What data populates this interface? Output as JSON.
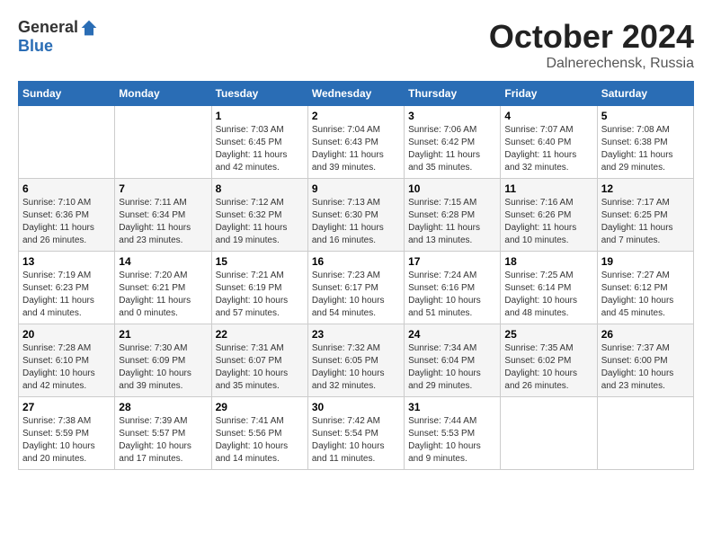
{
  "header": {
    "logo_general": "General",
    "logo_blue": "Blue",
    "month": "October 2024",
    "location": "Dalnerechensk, Russia"
  },
  "days_of_week": [
    "Sunday",
    "Monday",
    "Tuesday",
    "Wednesday",
    "Thursday",
    "Friday",
    "Saturday"
  ],
  "weeks": [
    [
      {
        "num": "",
        "detail": ""
      },
      {
        "num": "",
        "detail": ""
      },
      {
        "num": "1",
        "detail": "Sunrise: 7:03 AM\nSunset: 6:45 PM\nDaylight: 11 hours and 42 minutes."
      },
      {
        "num": "2",
        "detail": "Sunrise: 7:04 AM\nSunset: 6:43 PM\nDaylight: 11 hours and 39 minutes."
      },
      {
        "num": "3",
        "detail": "Sunrise: 7:06 AM\nSunset: 6:42 PM\nDaylight: 11 hours and 35 minutes."
      },
      {
        "num": "4",
        "detail": "Sunrise: 7:07 AM\nSunset: 6:40 PM\nDaylight: 11 hours and 32 minutes."
      },
      {
        "num": "5",
        "detail": "Sunrise: 7:08 AM\nSunset: 6:38 PM\nDaylight: 11 hours and 29 minutes."
      }
    ],
    [
      {
        "num": "6",
        "detail": "Sunrise: 7:10 AM\nSunset: 6:36 PM\nDaylight: 11 hours and 26 minutes."
      },
      {
        "num": "7",
        "detail": "Sunrise: 7:11 AM\nSunset: 6:34 PM\nDaylight: 11 hours and 23 minutes."
      },
      {
        "num": "8",
        "detail": "Sunrise: 7:12 AM\nSunset: 6:32 PM\nDaylight: 11 hours and 19 minutes."
      },
      {
        "num": "9",
        "detail": "Sunrise: 7:13 AM\nSunset: 6:30 PM\nDaylight: 11 hours and 16 minutes."
      },
      {
        "num": "10",
        "detail": "Sunrise: 7:15 AM\nSunset: 6:28 PM\nDaylight: 11 hours and 13 minutes."
      },
      {
        "num": "11",
        "detail": "Sunrise: 7:16 AM\nSunset: 6:26 PM\nDaylight: 11 hours and 10 minutes."
      },
      {
        "num": "12",
        "detail": "Sunrise: 7:17 AM\nSunset: 6:25 PM\nDaylight: 11 hours and 7 minutes."
      }
    ],
    [
      {
        "num": "13",
        "detail": "Sunrise: 7:19 AM\nSunset: 6:23 PM\nDaylight: 11 hours and 4 minutes."
      },
      {
        "num": "14",
        "detail": "Sunrise: 7:20 AM\nSunset: 6:21 PM\nDaylight: 11 hours and 0 minutes."
      },
      {
        "num": "15",
        "detail": "Sunrise: 7:21 AM\nSunset: 6:19 PM\nDaylight: 10 hours and 57 minutes."
      },
      {
        "num": "16",
        "detail": "Sunrise: 7:23 AM\nSunset: 6:17 PM\nDaylight: 10 hours and 54 minutes."
      },
      {
        "num": "17",
        "detail": "Sunrise: 7:24 AM\nSunset: 6:16 PM\nDaylight: 10 hours and 51 minutes."
      },
      {
        "num": "18",
        "detail": "Sunrise: 7:25 AM\nSunset: 6:14 PM\nDaylight: 10 hours and 48 minutes."
      },
      {
        "num": "19",
        "detail": "Sunrise: 7:27 AM\nSunset: 6:12 PM\nDaylight: 10 hours and 45 minutes."
      }
    ],
    [
      {
        "num": "20",
        "detail": "Sunrise: 7:28 AM\nSunset: 6:10 PM\nDaylight: 10 hours and 42 minutes."
      },
      {
        "num": "21",
        "detail": "Sunrise: 7:30 AM\nSunset: 6:09 PM\nDaylight: 10 hours and 39 minutes."
      },
      {
        "num": "22",
        "detail": "Sunrise: 7:31 AM\nSunset: 6:07 PM\nDaylight: 10 hours and 35 minutes."
      },
      {
        "num": "23",
        "detail": "Sunrise: 7:32 AM\nSunset: 6:05 PM\nDaylight: 10 hours and 32 minutes."
      },
      {
        "num": "24",
        "detail": "Sunrise: 7:34 AM\nSunset: 6:04 PM\nDaylight: 10 hours and 29 minutes."
      },
      {
        "num": "25",
        "detail": "Sunrise: 7:35 AM\nSunset: 6:02 PM\nDaylight: 10 hours and 26 minutes."
      },
      {
        "num": "26",
        "detail": "Sunrise: 7:37 AM\nSunset: 6:00 PM\nDaylight: 10 hours and 23 minutes."
      }
    ],
    [
      {
        "num": "27",
        "detail": "Sunrise: 7:38 AM\nSunset: 5:59 PM\nDaylight: 10 hours and 20 minutes."
      },
      {
        "num": "28",
        "detail": "Sunrise: 7:39 AM\nSunset: 5:57 PM\nDaylight: 10 hours and 17 minutes."
      },
      {
        "num": "29",
        "detail": "Sunrise: 7:41 AM\nSunset: 5:56 PM\nDaylight: 10 hours and 14 minutes."
      },
      {
        "num": "30",
        "detail": "Sunrise: 7:42 AM\nSunset: 5:54 PM\nDaylight: 10 hours and 11 minutes."
      },
      {
        "num": "31",
        "detail": "Sunrise: 7:44 AM\nSunset: 5:53 PM\nDaylight: 10 hours and 9 minutes."
      },
      {
        "num": "",
        "detail": ""
      },
      {
        "num": "",
        "detail": ""
      }
    ]
  ]
}
